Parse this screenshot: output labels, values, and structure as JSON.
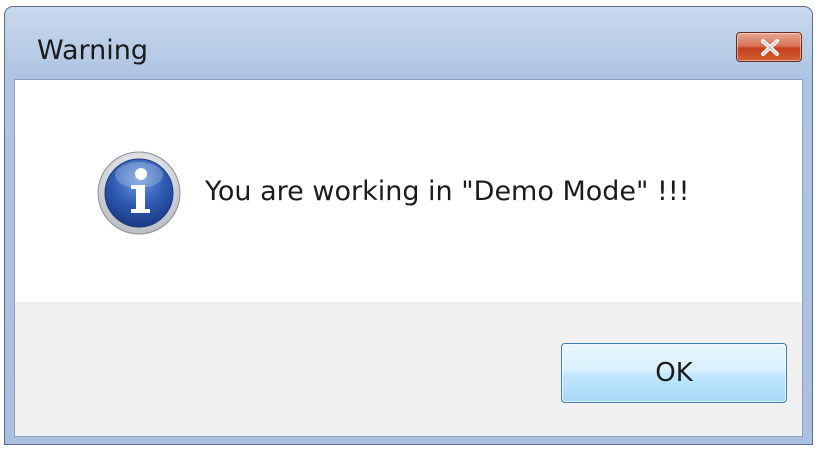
{
  "window": {
    "title": "Warning"
  },
  "dialog": {
    "icon": "information-icon",
    "message": "You are working in \"Demo Mode\" !!!",
    "ok_label": "OK"
  },
  "colors": {
    "title_bar": "#b9cde6",
    "close_button": "#c5401f",
    "ok_button": "#bee6fd",
    "footer": "#f0f0f0"
  }
}
